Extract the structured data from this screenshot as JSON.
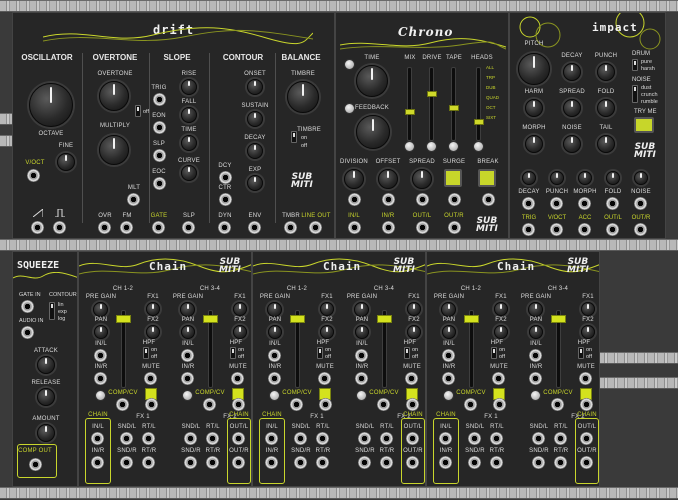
{
  "drift": {
    "title": "drift",
    "sections": [
      "OSCILLATOR",
      "OVERTONE",
      "SLOPE",
      "CONTOUR",
      "BALANCE"
    ],
    "knobs": {
      "octave": "OCTAVE",
      "fine": "FINE",
      "overtone": "OVERTONE",
      "multiply": "MULTIPLY",
      "rise": "RISE",
      "fall": "FALL",
      "time": "TIME",
      "curve": "CURVE",
      "onset": "ONSET",
      "sustain": "SUSTAIN",
      "decay": "DECAY",
      "exp": "EXP",
      "timbre": "TIMBRE"
    },
    "labels": {
      "voct": "V/OCT",
      "off": "off",
      "trig": "TRIG",
      "eon": "EON",
      "slp": "SLP",
      "eoc": "EOC",
      "mlt": "MLT",
      "dcy": "DCY",
      "ctr": "CTR",
      "timbre_sw": "TIMBRE",
      "on": "on",
      "off2": "off"
    },
    "bottom": [
      "OVR",
      "FM",
      "GATE",
      "SLP",
      "DYN",
      "ENV",
      "TMBR",
      "LINE OUT"
    ]
  },
  "chrono": {
    "title": "Chrono",
    "knobs": {
      "time": "TIME",
      "feedback": "FEEDBACK",
      "division": "DIVISION",
      "offset": "OFFSET",
      "spread": "SPREAD"
    },
    "faders": [
      "MIX",
      "DRIVE",
      "TAPE",
      "HEADS"
    ],
    "heads": [
      "ALL",
      "TRP",
      "DUB",
      "QUAD",
      "OCT",
      "SIXT"
    ],
    "buttons": {
      "surge": "SURGE",
      "break": "BREAK"
    },
    "bottom": [
      "IN/L",
      "IN/R",
      "OUT/L",
      "OUT/R"
    ]
  },
  "impact": {
    "title": "impact",
    "knobs": [
      "PITCH",
      "DECAY",
      "PUNCH",
      "HARM",
      "SPREAD",
      "FOLD",
      "MORPH",
      "NOISE",
      "TAIL"
    ],
    "drum": {
      "label": "DRUM",
      "options": [
        "pure",
        "harsh"
      ]
    },
    "noise": {
      "label": "NOISE",
      "options": [
        "dust",
        "crunch",
        "rumble"
      ]
    },
    "try_me": "TRY ME",
    "cv_row": [
      "DECAY",
      "PUNCH",
      "MORPH",
      "FOLD",
      "NOISE"
    ],
    "bottom": [
      "TRIG",
      "V/OCT",
      "ACC",
      "OUT/L",
      "OUT/R"
    ]
  },
  "squeeze": {
    "title": "SQUEEZE",
    "labels": {
      "gate_in": "GATE IN",
      "audio_in": "AUDIO IN",
      "contour": "CONTOUR",
      "lin": "lin",
      "exp": "exp",
      "log": "log",
      "attack": "ATTACK",
      "release": "RELEASE",
      "amount": "AMOUNT",
      "comp_out": "COMP OUT"
    }
  },
  "chain": {
    "title": "Chain",
    "channels": [
      {
        "name": "CH 1-2",
        "fx": "FX1",
        "fx_bus": "FX 1"
      },
      {
        "name": "CH 3-4",
        "fx": "FX1",
        "fx_bus": "FX 2"
      },
      {
        "name": "CH 1-2",
        "fx": "FX1",
        "fx_bus": "FX 1"
      },
      {
        "name": "CH 3-4",
        "fx": "FX1",
        "fx_bus": "FX 2"
      },
      {
        "name": "CH 1-2",
        "fx": "FX1",
        "fx_bus": "FX 1"
      },
      {
        "name": "CH 3-4",
        "fx": "FX1",
        "fx_bus": "FX 2"
      }
    ],
    "labels": {
      "pre_gain": "PRE GAIN",
      "pan": "PAN",
      "fx2": "FX2",
      "hpf": "HPF",
      "on": "on",
      "off": "off",
      "inl": "IN/L",
      "inr": "IN/R",
      "mute": "MUTE",
      "comp_cv": "COMP/CV",
      "chain": "CHAIN",
      "sndl": "SND/L",
      "sndr": "SND/R",
      "rtl": "RT/L",
      "rtr": "RT/R",
      "outl": "OUT/L",
      "outr": "OUT/R"
    }
  },
  "brand": {
    "line1": "SUB",
    "line2": "MITI"
  },
  "colors": {
    "accent": "#c9d62c",
    "panel": "#262626",
    "rail": "#b8b8b8"
  }
}
